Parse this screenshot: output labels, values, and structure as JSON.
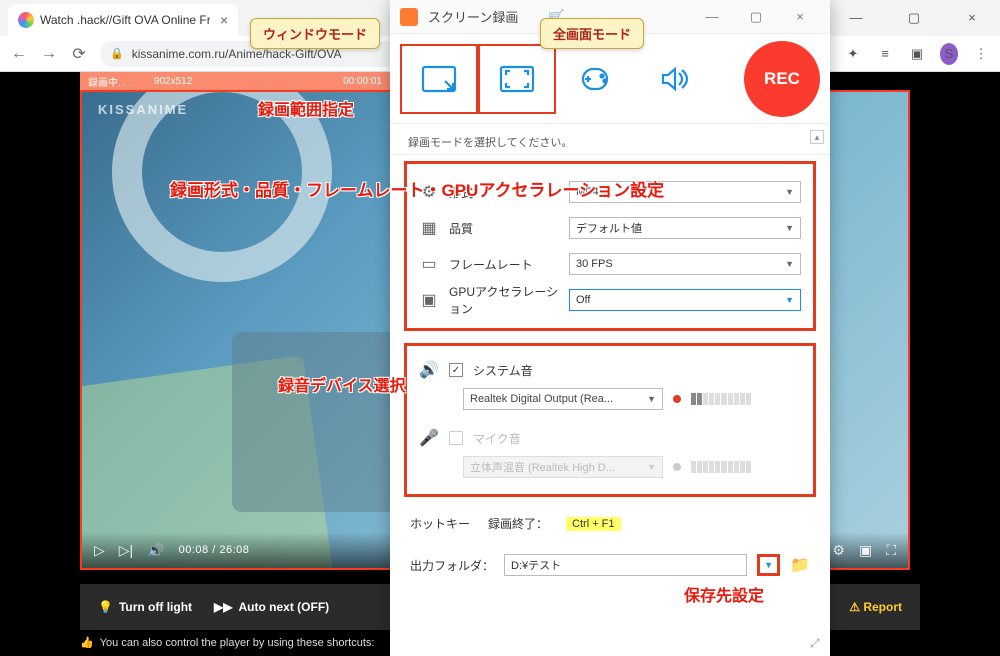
{
  "browser": {
    "tab_title": "Watch .hack//Gift OVA Online Fre",
    "url": "kissanime.com.ru/Anime/hack-Gift/OVA",
    "user_initial": "S"
  },
  "recording_overlay": {
    "status": "録画中. . .",
    "dimensions": "902x512",
    "time": "00:00:01"
  },
  "video": {
    "watermark": "KISSANIME",
    "current_time": "00:08",
    "total_time": "26:08"
  },
  "under_bar": {
    "turn_off": "Turn off light",
    "auto_next": "Auto next (OFF)",
    "report": "Report",
    "shortcuts_text": "You can also control the player by using these shortcuts:"
  },
  "callouts": {
    "window_mode": "ウィンドウモード",
    "fullscreen_mode": "全画面モード"
  },
  "annotations": {
    "range_spec": "録画範囲指定",
    "format_settings": "録画形式・品質・フレームレート・GPUアクセラレーション設定",
    "audio_device": "録音デバイス選択",
    "save_dest": "保存先設定"
  },
  "app": {
    "title": "スクリーン録画",
    "rec_label": "REC",
    "mode_msg": "録画モードを選択してください。",
    "settings": {
      "format_label": "形式",
      "format_value": "MP4",
      "quality_label": "品質",
      "quality_value": "デフォルト値",
      "fps_label": "フレームレート",
      "fps_value": "30 FPS",
      "gpu_label": "GPUアクセラレーション",
      "gpu_value": "Off"
    },
    "audio": {
      "system_label": "システム音",
      "system_device": "Realtek Digital Output (Rea...",
      "mic_label": "マイク音",
      "mic_device": "立体声混音 (Realtek High D..."
    },
    "hotkey": {
      "label": "ホットキー",
      "stop_label": "録画終了：",
      "stop_key": "Ctrl + F1"
    },
    "output": {
      "label": "出力フォルダ：",
      "path": "D:¥テスト"
    }
  }
}
